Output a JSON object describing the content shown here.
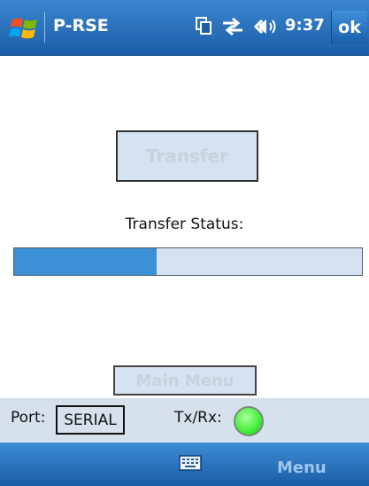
{
  "titlebar": {
    "app_title": "P-RSE",
    "time": "9:37",
    "ok_label": "ok",
    "icons": [
      "windows-flag-icon",
      "copy-icon",
      "connectivity-icon",
      "volume-icon"
    ]
  },
  "main": {
    "transfer_label": "Transfer",
    "transfer_status_label": "Transfer Status:",
    "progress_fraction": 0.41,
    "main_menu_label": "Main Menu"
  },
  "statusbar": {
    "port_label": "Port:",
    "port_value": "SERIAL",
    "txrx_label": "Tx/Rx:",
    "led_color": "#42ef3a"
  },
  "softkeys": {
    "keyboard_icon": "keyboard-icon",
    "menu_label": "Menu"
  },
  "colors": {
    "accent": "#1c5ea8",
    "progress": "#3b90d6",
    "panel": "#d5e2ef"
  }
}
